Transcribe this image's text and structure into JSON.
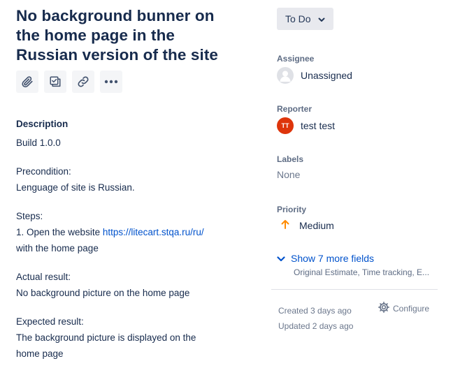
{
  "issue": {
    "title_lines": [
      "No background bunner on",
      "the home page in the",
      "Russian version of the site"
    ]
  },
  "toolbar": {
    "icons": [
      "paperclip-icon",
      "subtask-icon",
      "link-icon",
      "more-icon"
    ]
  },
  "description": {
    "heading": "Description",
    "build": "Build 1.0.0",
    "precondition_label": "Precondition:",
    "precondition_text": "Lenguage of site is Russian.",
    "steps_label": "Steps:",
    "step1_prefix": "1. Open the website ",
    "step1_link": "https://litecart.stqa.ru/ru/",
    "step1_suffix": "with the home page",
    "actual_label": "Actual result:",
    "actual_text": "No background picture on the home page",
    "expected_label": "Expected result:",
    "expected_line1": "The background picture is displayed on the",
    "expected_line2": "home page"
  },
  "status": {
    "label": "To Do"
  },
  "fields": {
    "assignee_label": "Assignee",
    "assignee_value": "Unassigned",
    "reporter_label": "Reporter",
    "reporter_initials": "TT",
    "reporter_value": "test test",
    "labels_label": "Labels",
    "labels_value": "None",
    "priority_label": "Priority",
    "priority_value": "Medium"
  },
  "more_fields": {
    "label": "Show 7 more fields",
    "sub": "Original Estimate, Time tracking, E..."
  },
  "meta": {
    "created": "Created 3 days ago",
    "updated": "Updated 2 days ago",
    "configure": "Configure"
  },
  "colors": {
    "link": "#0052cc",
    "priority_medium": "#ff8b00",
    "reporter_avatar": "#de350b"
  }
}
